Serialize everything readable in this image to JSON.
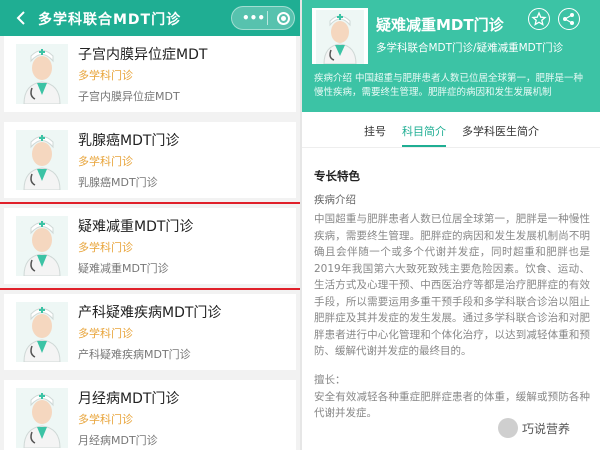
{
  "left": {
    "header": {
      "title": "多学科联合MDT门诊",
      "back_icon": "chevron-left-icon",
      "more_icon": "more-dots-icon",
      "close_icon": "target-circle-icon"
    },
    "clinics": [
      {
        "name": "子宫内膜异位症MDT",
        "type": "多学科门诊",
        "sub": "子宫内膜异位症MDT",
        "highlight": false
      },
      {
        "name": "乳腺癌MDT门诊",
        "type": "多学科门诊",
        "sub": "乳腺癌MDT门诊",
        "highlight": false
      },
      {
        "name": "疑难减重MDT门诊",
        "type": "多学科门诊",
        "sub": "疑难减重MDT门诊",
        "highlight": true
      },
      {
        "name": "产科疑难疾病MDT门诊",
        "type": "多学科门诊",
        "sub": "产科疑难疾病MDT门诊",
        "highlight": false
      },
      {
        "name": "月经病MDT门诊",
        "type": "多学科门诊",
        "sub": "月经病MDT门诊",
        "highlight": false
      }
    ]
  },
  "right": {
    "hero": {
      "title": "疑难减重MDT门诊",
      "path": "多学科联合MDT门诊/疑难减重MDT门诊",
      "intro": "疾病介绍 中国超重与肥胖患者人数已位居全球第一，肥胖是一种慢性疾病，需要终生管理。肥胖症的病因和发生发展机制",
      "star_icon": "star-icon",
      "share_icon": "share-icon"
    },
    "tabs": [
      {
        "label": "挂号",
        "active": false
      },
      {
        "label": "科目简介",
        "active": true
      },
      {
        "label": "多学科医生简介",
        "active": false
      }
    ],
    "content": {
      "section_title": "专长特色",
      "disease_label": "疾病介绍",
      "paragraph": "中国超重与肥胖患者人数已位居全球第一，肥胖是一种慢性疾病，需要终生管理。肥胖症的病因和发生发展机制尚不明确且会伴随一个或多个代谢并发症，同时超重和肥胖也是2019年我国第六大致死致残主要危险因素。饮食、运动、生活方式及心理干预、中西医治疗等都是治疗肥胖症的有效手段，所以需要运用多重干预手段和多学科联合诊治以阻止肥胖症及其并发症的发生发展。通过多学科联合诊治和对肥胖患者进行中心化管理和个体化治疗，以达到减轻体重和预防、缓解代谢并发症的最终目的。",
      "expertise_label": "擅长：",
      "expertise_text": "安全有效减轻各种重症肥胖症患者的体重，缓解或预防各种代谢并发症。"
    },
    "accent_color": "#1fae93",
    "highlight_color": "#e0202a"
  },
  "watermark": {
    "text": "巧说营养"
  }
}
